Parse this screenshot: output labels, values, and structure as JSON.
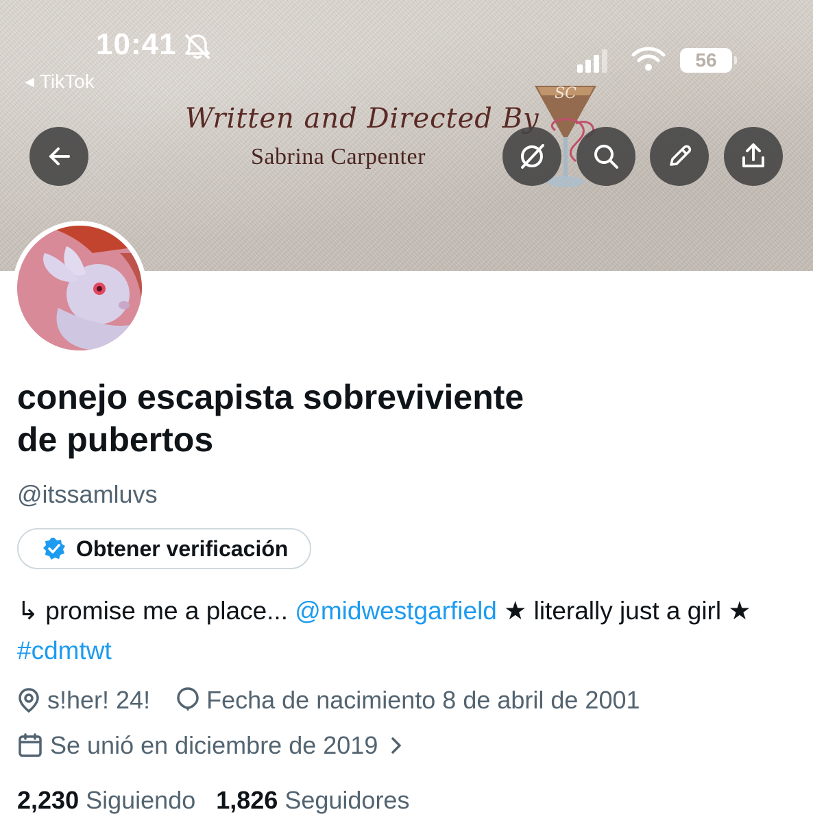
{
  "status_bar": {
    "time": "10:41",
    "back_app": "TikTok",
    "battery": "56"
  },
  "banner": {
    "script_text": "Written and Directed By",
    "name_text": "Sabrina Carpenter"
  },
  "toolbar": {
    "back": "arrow-left-icon",
    "grok": "grok-icon",
    "search": "search-icon",
    "edit": "pencil-icon",
    "share": "share-icon"
  },
  "profile": {
    "display_name_line1": "conejo escapista sobreviviente",
    "display_name_line2": "de pubertos",
    "handle": "@itssamluvs",
    "verify_label": "Obtener verificación",
    "bio": {
      "prefix": "↳ promise me a place... ",
      "mention": "@midwestgarfield",
      "middle": " ★ literally just a girl ★ ",
      "hashtag": "#cdmtwt"
    },
    "location": "s!her! 24!",
    "birthday": "Fecha de nacimiento 8 de abril de 2001",
    "joined": "Se unió en diciembre de 2019",
    "following_count": "2,230",
    "following_label": "Siguiendo",
    "followers_count": "1,826",
    "followers_label": "Seguidores"
  },
  "colors": {
    "accent": "#1d9bf0",
    "secondary_text": "#536471",
    "primary_text": "#0f1419"
  }
}
